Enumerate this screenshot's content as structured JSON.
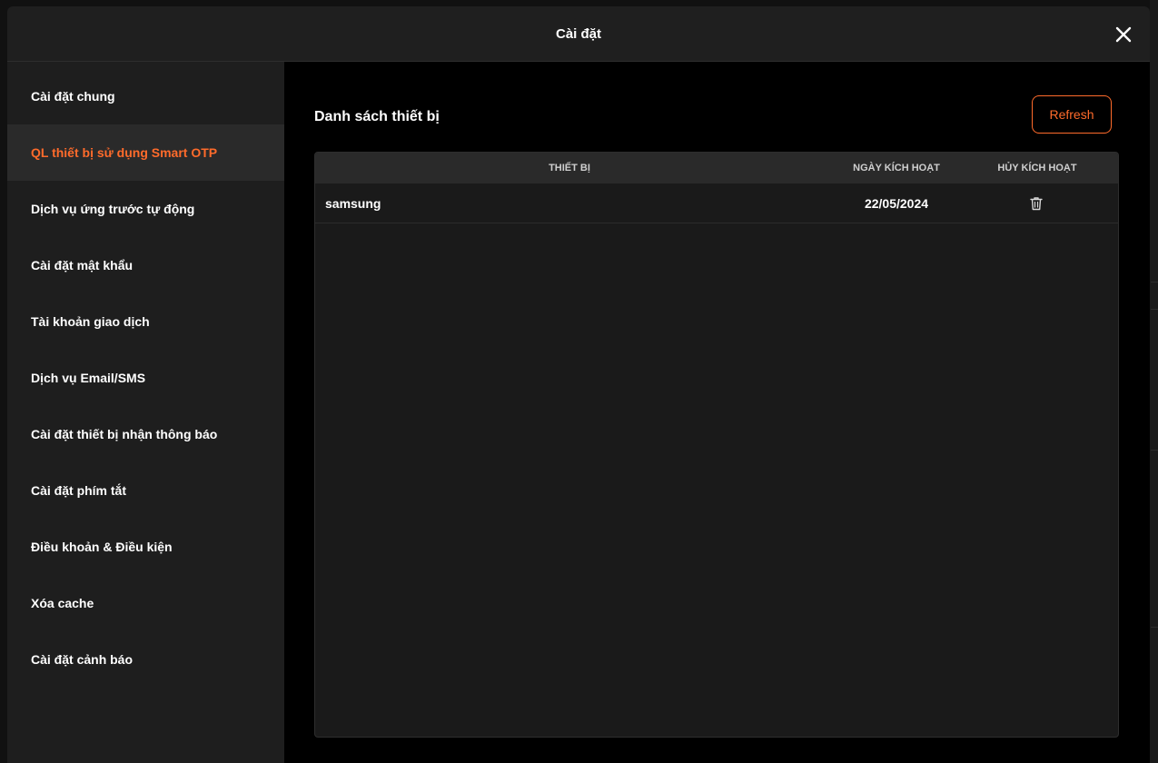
{
  "modal": {
    "title": "Cài đặt"
  },
  "sidebar": {
    "active_index": 1,
    "items": [
      {
        "label": "Cài đặt chung"
      },
      {
        "label": "QL thiết bị sử dụng Smart OTP"
      },
      {
        "label": "Dịch vụ ứng trước tự động"
      },
      {
        "label": "Cài đặt mật khẩu"
      },
      {
        "label": "Tài khoản giao dịch"
      },
      {
        "label": "Dịch vụ Email/SMS"
      },
      {
        "label": "Cài đặt thiết bị nhận thông báo"
      },
      {
        "label": "Cài đặt phím tắt"
      },
      {
        "label": "Điều khoản & Điều kiện"
      },
      {
        "label": "Xóa cache"
      },
      {
        "label": "Cài đặt cảnh báo"
      }
    ]
  },
  "main": {
    "section_title": "Danh sách thiết bị",
    "refresh_label": "Refresh",
    "table": {
      "columns": [
        "THIẾT BỊ",
        "NGÀY KÍCH HOẠT",
        "HỦY KÍCH HOẠT"
      ],
      "rows": [
        {
          "device": "samsung",
          "activated_date": "22/05/2024",
          "action_icon": "trash-icon"
        }
      ]
    }
  },
  "colors": {
    "accent": "#ff6b2b",
    "header_bg": "#1f1f1f",
    "sidebar_bg": "#1e1e1e",
    "sidebar_active_bg": "#2a2a2a",
    "content_bg": "#000000",
    "table_bg": "#1a1a1a",
    "table_header_bg": "#2a2a2a"
  },
  "icons": {
    "close": "close-icon",
    "delete": "trash-icon"
  }
}
